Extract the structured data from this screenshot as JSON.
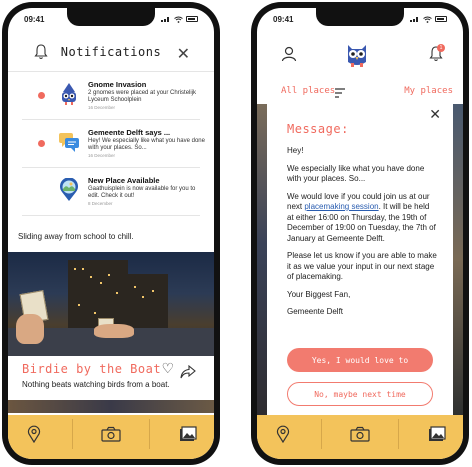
{
  "status": {
    "time": "09:41"
  },
  "notifications_screen": {
    "header_title": "Notifications",
    "items": [
      {
        "title": "Gnome Invasion",
        "body": "2 gnomes were placed at your Christelijk Lyceum Schoolplein",
        "date": "16 December",
        "unread": true,
        "icon": "gnome-icon"
      },
      {
        "title": "Gemeente Delft says ...",
        "body": "Hey! We especially like what you have done with your places. So...",
        "date": "16 December",
        "unread": true,
        "icon": "chat-icon"
      },
      {
        "title": "New Place Available",
        "body": "Gaathuisplein is now available for you to edit. Check it out!",
        "date": "8 December",
        "unread": false,
        "icon": "map-pin-icon"
      }
    ],
    "feed_caption": "Sliding away from school to chill.",
    "post": {
      "title": "Birdie by the Boat",
      "description": "Nothing beats watching birds from a boat."
    }
  },
  "message_screen": {
    "bell_badge": "1",
    "filter_all": "All places",
    "filter_mine": "My places",
    "modal": {
      "title": "Message:",
      "greeting": "Hey!",
      "p1": "We especially like what you have done with your places. So...",
      "p2_before": "We would love if you could join us at our next ",
      "p2_link": "placemaking session",
      "p2_after": ". It will be held at either 16:00 on Thursday, the 19th of December of 19:00 on Tuesday, the 7th of January at Gemeente Delft.",
      "p3": "Please let us know if you are able to make it as we value your input in our next stage of placemaking.",
      "sign1": "Your Biggest Fan,",
      "sign2": "Gemeente Delft",
      "btn_yes": "Yes, I would love to",
      "btn_no": "No, maybe next time"
    }
  },
  "tabbar": {
    "tabs": [
      "map-pin-icon",
      "camera-icon",
      "gallery-icon"
    ]
  },
  "colors": {
    "accent": "#f06a5e",
    "tabbar": "#f3c35b",
    "link": "#2a5db0"
  }
}
